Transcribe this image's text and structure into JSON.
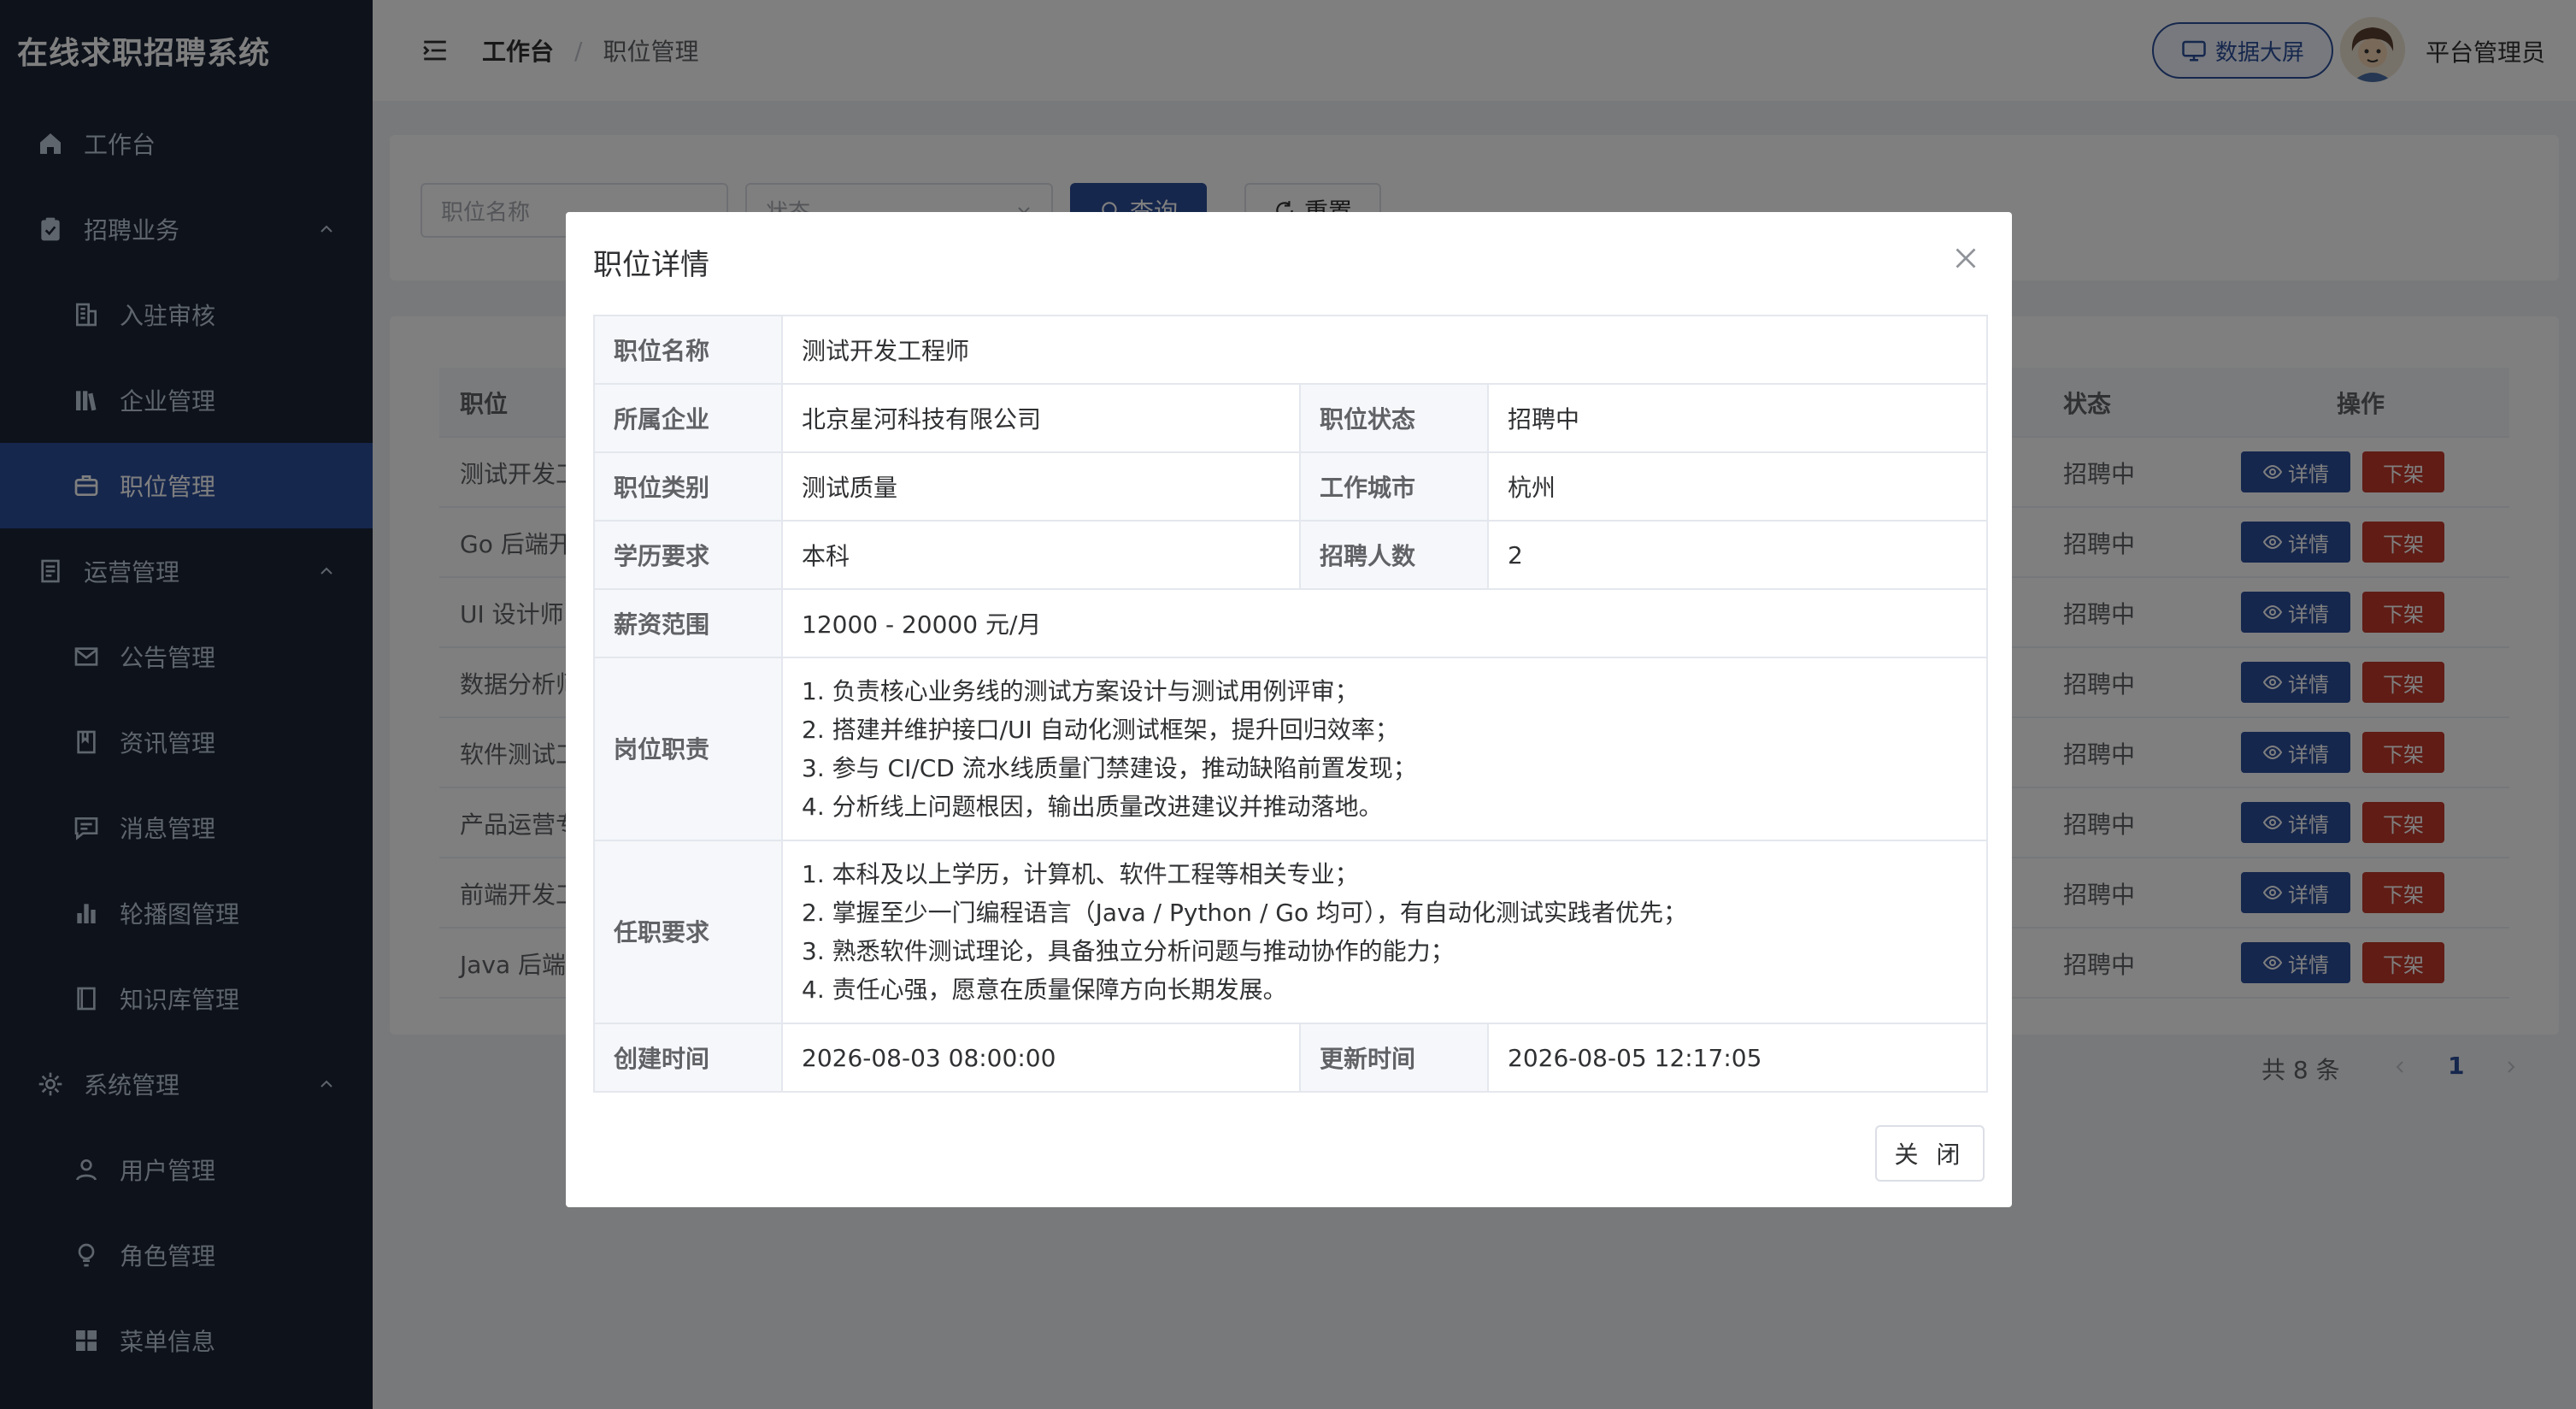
{
  "app": {
    "title": "在线求职招聘系统"
  },
  "sidebar": {
    "items": [
      {
        "label": "工作台",
        "icon": "home-icon"
      },
      {
        "label": "招聘业务",
        "icon": "clipboard-icon"
      },
      {
        "label": "入驻审核",
        "icon": "building-icon"
      },
      {
        "label": "企业管理",
        "icon": "library-icon"
      },
      {
        "label": "职位管理",
        "icon": "briefcase-icon"
      },
      {
        "label": "运营管理",
        "icon": "document-icon"
      },
      {
        "label": "公告管理",
        "icon": "mail-icon"
      },
      {
        "label": "资讯管理",
        "icon": "notebook-icon"
      },
      {
        "label": "消息管理",
        "icon": "chat-icon"
      },
      {
        "label": "轮播图管理",
        "icon": "bar-chart-icon"
      },
      {
        "label": "知识库管理",
        "icon": "book-icon"
      },
      {
        "label": "系统管理",
        "icon": "gear-icon"
      },
      {
        "label": "用户管理",
        "icon": "user-icon"
      },
      {
        "label": "角色管理",
        "icon": "lightbulb-icon"
      },
      {
        "label": "菜单信息",
        "icon": "grid-icon"
      }
    ]
  },
  "header": {
    "breadcrumb_root": "工作台",
    "breadcrumb_sep": "/",
    "breadcrumb_current": "职位管理",
    "screen_button": "数据大屏",
    "user_name": "平台管理员"
  },
  "filter": {
    "name_placeholder": "职位名称",
    "status_placeholder": "状态",
    "query_label": "查询",
    "reset_label": "重置"
  },
  "table": {
    "headers": {
      "position": "职位",
      "status": "状态",
      "action": "操作"
    },
    "rows": [
      {
        "position": "测试开发工程师",
        "status": "招聘中"
      },
      {
        "position": "Go 后端开发工程师",
        "status": "招聘中"
      },
      {
        "position": "UI 设计师",
        "status": "招聘中"
      },
      {
        "position": "数据分析师",
        "status": "招聘中"
      },
      {
        "position": "软件测试工程师",
        "status": "招聘中"
      },
      {
        "position": "产品运营专员",
        "status": "招聘中"
      },
      {
        "position": "前端开发工程师",
        "status": "招聘中"
      },
      {
        "position": "Java 后端开发工程师",
        "status": "招聘中"
      }
    ],
    "detail_label": "详情",
    "offline_label": "下架",
    "total_label": "共 8 条",
    "current_page": "1"
  },
  "dialog": {
    "title": "职位详情",
    "labels": {
      "name": "职位名称",
      "company": "所属企业",
      "status": "职位状态",
      "category": "职位类别",
      "city": "工作城市",
      "education": "学历要求",
      "headcount": "招聘人数",
      "salary": "薪资范围",
      "duties": "岗位职责",
      "requirements": "任职要求",
      "created": "创建时间",
      "updated": "更新时间"
    },
    "values": {
      "name": "测试开发工程师",
      "company": "北京星河科技有限公司",
      "status": "招聘中",
      "category": "测试质量",
      "city": "杭州",
      "education": "本科",
      "headcount": "2",
      "salary": "12000 - 20000 元/月",
      "duties": [
        "1. 负责核心业务线的测试方案设计与测试用例评审；",
        "2. 搭建并维护接口/UI 自动化测试框架，提升回归效率；",
        "3. 参与 CI/CD 流水线质量门禁建设，推动缺陷前置发现；",
        "4. 分析线上问题根因，输出质量改进建议并推动落地。"
      ],
      "requirements": [
        "1. 本科及以上学历，计算机、软件工程等相关专业；",
        "2. 掌握至少一门编程语言（Java / Python / Go 均可），有自动化测试实践者优先；",
        "3. 熟悉软件测试理论，具备独立分析问题与推动协作的能力；",
        "4. 责任心强，愿意在质量保障方向长期发展。"
      ],
      "created": "2026-08-03 08:00:00",
      "updated": "2026-08-05 12:17:05"
    },
    "close_label": "关 闭"
  },
  "colors": {
    "sidebar_bg": "#1b2537",
    "accent": "#2d4e9a",
    "danger": "#c0392b"
  }
}
